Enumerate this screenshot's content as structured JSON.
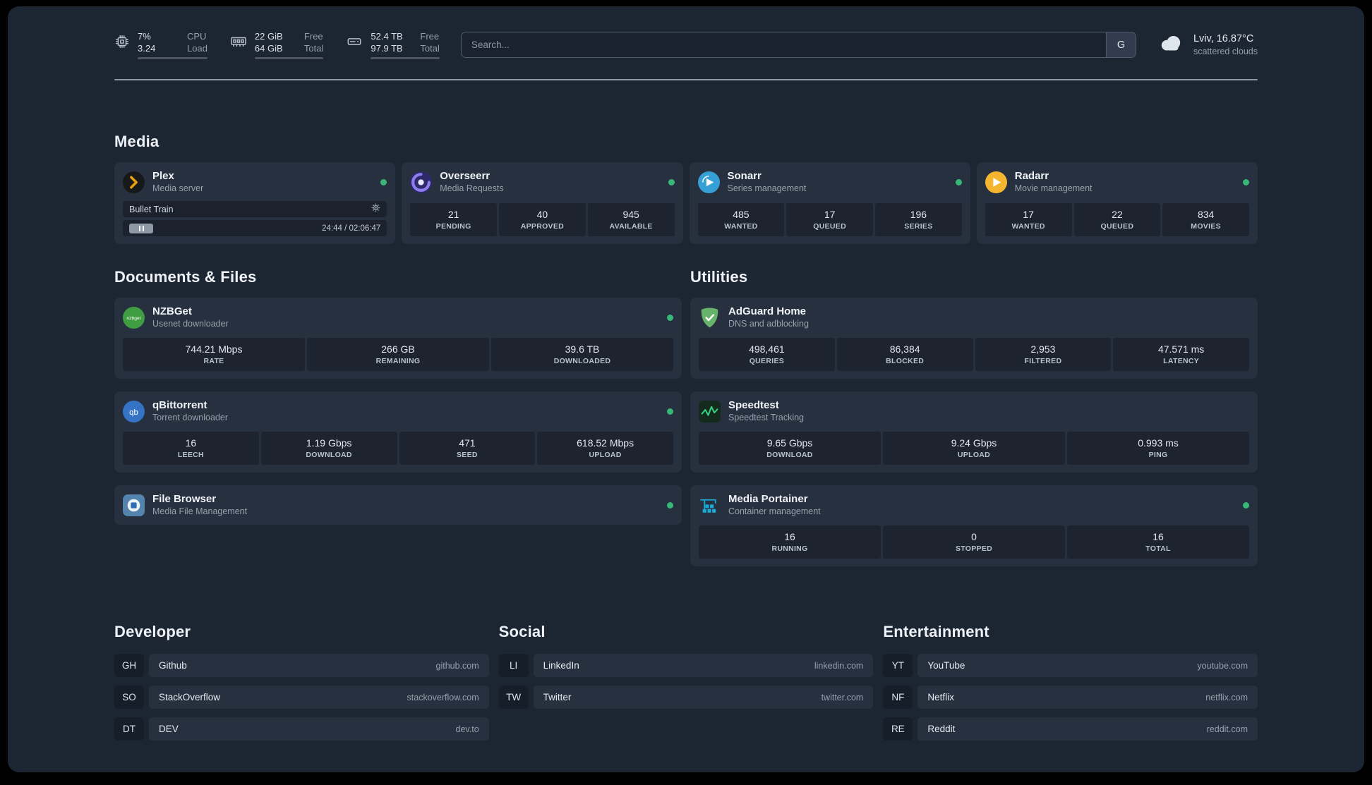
{
  "topbar": {
    "resources": [
      {
        "rows": [
          {
            "value": "7%",
            "label": "CPU"
          },
          {
            "value": "3.24",
            "label": "Load"
          }
        ],
        "progress_pct": 7
      },
      {
        "rows": [
          {
            "value": "22 GiB",
            "label": "Free"
          },
          {
            "value": "64 GiB",
            "label": "Total"
          }
        ],
        "progress_pct": 66
      },
      {
        "rows": [
          {
            "value": "52.4 TB",
            "label": "Free"
          },
          {
            "value": "97.9 TB",
            "label": "Total"
          }
        ],
        "progress_pct": 46
      }
    ],
    "search": {
      "placeholder": "Search...",
      "provider_label": "G"
    },
    "weather": {
      "location": "Lviv, 16.87°C",
      "condition": "scattered clouds"
    }
  },
  "media": {
    "title": "Media",
    "cards": [
      {
        "name": "Plex",
        "desc": "Media server",
        "status": "online",
        "player": {
          "title": "Bullet Train",
          "time": "24:44 / 02:06:47"
        }
      },
      {
        "name": "Overseerr",
        "desc": "Media Requests",
        "status": "online",
        "stats": [
          {
            "value": "21",
            "label": "PENDING"
          },
          {
            "value": "40",
            "label": "APPROVED"
          },
          {
            "value": "945",
            "label": "AVAILABLE"
          }
        ]
      },
      {
        "name": "Sonarr",
        "desc": "Series management",
        "status": "online",
        "stats": [
          {
            "value": "485",
            "label": "WANTED"
          },
          {
            "value": "17",
            "label": "QUEUED"
          },
          {
            "value": "196",
            "label": "SERIES"
          }
        ]
      },
      {
        "name": "Radarr",
        "desc": "Movie management",
        "status": "online",
        "stats": [
          {
            "value": "17",
            "label": "WANTED"
          },
          {
            "value": "22",
            "label": "QUEUED"
          },
          {
            "value": "834",
            "label": "MOVIES"
          }
        ]
      }
    ]
  },
  "documents": {
    "title": "Documents & Files",
    "cards": [
      {
        "name": "NZBGet",
        "desc": "Usenet downloader",
        "status": "online",
        "stats": [
          {
            "value": "744.21 Mbps",
            "label": "RATE"
          },
          {
            "value": "266 GB",
            "label": "REMAINING"
          },
          {
            "value": "39.6 TB",
            "label": "DOWNLOADED"
          }
        ]
      },
      {
        "name": "qBittorrent",
        "desc": "Torrent downloader",
        "status": "online",
        "stats": [
          {
            "value": "16",
            "label": "LEECH"
          },
          {
            "value": "1.19 Gbps",
            "label": "DOWNLOAD"
          },
          {
            "value": "471",
            "label": "SEED"
          },
          {
            "value": "618.52 Mbps",
            "label": "UPLOAD"
          }
        ]
      },
      {
        "name": "File Browser",
        "desc": "Media File Management",
        "status": "online"
      }
    ]
  },
  "utilities": {
    "title": "Utilities",
    "cards": [
      {
        "name": "AdGuard Home",
        "desc": "DNS and adblocking",
        "stats": [
          {
            "value": "498,461",
            "label": "QUERIES"
          },
          {
            "value": "86,384",
            "label": "BLOCKED"
          },
          {
            "value": "2,953",
            "label": "FILTERED"
          },
          {
            "value": "47.571 ms",
            "label": "LATENCY"
          }
        ]
      },
      {
        "name": "Speedtest",
        "desc": "Speedtest Tracking",
        "stats": [
          {
            "value": "9.65 Gbps",
            "label": "DOWNLOAD"
          },
          {
            "value": "9.24 Gbps",
            "label": "UPLOAD"
          },
          {
            "value": "0.993 ms",
            "label": "PING"
          }
        ]
      },
      {
        "name": "Media Portainer",
        "desc": "Container management",
        "status": "online",
        "stats": [
          {
            "value": "16",
            "label": "RUNNING"
          },
          {
            "value": "0",
            "label": "STOPPED"
          },
          {
            "value": "16",
            "label": "TOTAL"
          }
        ]
      }
    ]
  },
  "bookmarks": {
    "groups": [
      {
        "title": "Developer",
        "links": [
          {
            "abbr": "GH",
            "name": "Github",
            "domain": "github.com"
          },
          {
            "abbr": "SO",
            "name": "StackOverflow",
            "domain": "stackoverflow.com"
          },
          {
            "abbr": "DT",
            "name": "DEV",
            "domain": "dev.to"
          }
        ]
      },
      {
        "title": "Social",
        "links": [
          {
            "abbr": "LI",
            "name": "LinkedIn",
            "domain": "linkedin.com"
          },
          {
            "abbr": "TW",
            "name": "Twitter",
            "domain": "twitter.com"
          }
        ]
      },
      {
        "title": "Entertainment",
        "links": [
          {
            "abbr": "YT",
            "name": "YouTube",
            "domain": "youtube.com"
          },
          {
            "abbr": "NF",
            "name": "Netflix",
            "domain": "netflix.com"
          },
          {
            "abbr": "RE",
            "name": "Reddit",
            "domain": "reddit.com"
          }
        ]
      }
    ]
  },
  "colors": {
    "status_online": "#38b878",
    "background": "#1c2532",
    "card": "#27303f"
  }
}
